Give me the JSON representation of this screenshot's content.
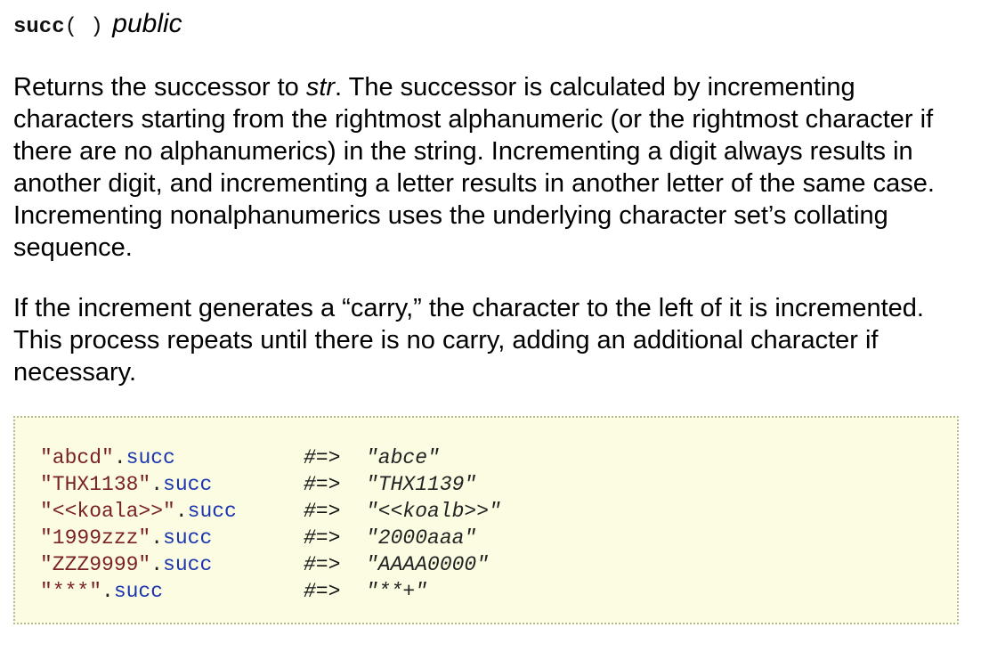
{
  "header": {
    "method_name": "succ",
    "parens": "( )",
    "visibility": "public"
  },
  "description": {
    "para1": {
      "before_arg": "Returns the successor to ",
      "arg": "str",
      "after_arg": ". The successor is calculated by incrementing characters starting from the rightmost alphanumeric (or the rightmost character if there are no alphanumerics) in the string. Incrementing a digit always results in another digit, and incrementing a letter results in another letter of the same case. Incrementing nonalphanumerics uses the underlying character set’s collating sequence."
    },
    "para2": "If the increment generates a “carry,” the character to the left of it is incremented. This process repeats until there is no carry, adding an additional character if necessary."
  },
  "examples": [
    {
      "receiver": "\"abcd\"",
      "dot": ".",
      "method": "succ",
      "arrow": "#=>",
      "result": "\"abce\""
    },
    {
      "receiver": "\"THX1138\"",
      "dot": ".",
      "method": "succ",
      "arrow": "#=>",
      "result": "\"THX1139\""
    },
    {
      "receiver": "\"<<koala>>\"",
      "dot": ".",
      "method": "succ",
      "arrow": "#=>",
      "result": "\"<<koalb>>\""
    },
    {
      "receiver": "\"1999zzz\"",
      "dot": ".",
      "method": "succ",
      "arrow": "#=>",
      "result": "\"2000aaa\""
    },
    {
      "receiver": "\"ZZZ9999\"",
      "dot": ".",
      "method": "succ",
      "arrow": "#=>",
      "result": "\"AAAA0000\""
    },
    {
      "receiver": "\"***\"",
      "dot": ".",
      "method": "succ",
      "arrow": "#=>",
      "result": "\"**+\""
    }
  ],
  "colors": {
    "code_background": "#fcfce2",
    "code_border": "#b8b898",
    "string_color": "#7a2222",
    "method_color": "#1a35b0"
  }
}
